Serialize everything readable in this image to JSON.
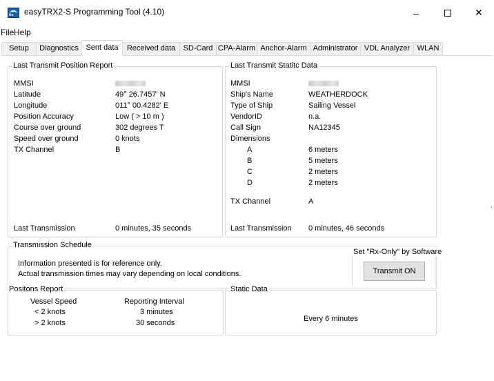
{
  "window": {
    "title": "easyTRX2-S Programming Tool  (4.10)",
    "icon_text": "trx",
    "minimize_glyph": "–",
    "close_glyph": "✕"
  },
  "menu": {
    "file": "File",
    "help": "Help"
  },
  "tabs": [
    {
      "label": "Setup"
    },
    {
      "label": "Diagnostics"
    },
    {
      "label": "Sent data",
      "active": true
    },
    {
      "label": "Received data"
    },
    {
      "label": "SD-Card"
    },
    {
      "label": "CPA-Alarm"
    },
    {
      "label": "Anchor-Alarm"
    },
    {
      "label": "Administrator"
    },
    {
      "label": "VDL Analyzer"
    },
    {
      "label": "WLAN"
    }
  ],
  "position_report": {
    "title": "Last Transmit Position Report",
    "rows": [
      {
        "label": "MMSI",
        "value": ""
      },
      {
        "label": "Latitude",
        "value": "49° 26.7457' N"
      },
      {
        "label": "Longitude",
        "value": "011° 00.4282' E"
      },
      {
        "label": "Position Accuracy",
        "value": "Low ( > 10 m )"
      },
      {
        "label": "Course over ground",
        "value": "302 degrees T"
      },
      {
        "label": "Speed over ground",
        "value": "0 knots"
      },
      {
        "label": "TX Channel",
        "value": "B"
      }
    ],
    "last_transmission_label": "Last Transmission",
    "last_transmission_value": "0 minutes, 35 seconds"
  },
  "static_data": {
    "title": "Last Transmit Statitc Data",
    "rows": [
      {
        "label": "MMSI",
        "value": ""
      },
      {
        "label": "Ship's Name",
        "value": "WEATHERDOCK"
      },
      {
        "label": "Type of Ship",
        "value": "Sailing Vessel"
      },
      {
        "label": "VendorID",
        "value": "n.a."
      },
      {
        "label": "Call Sign",
        "value": "NA12345"
      },
      {
        "label": "Dimensions",
        "value": ""
      }
    ],
    "dimensions": [
      {
        "label": "A",
        "value": "6 meters"
      },
      {
        "label": "B",
        "value": "5 meters"
      },
      {
        "label": "C",
        "value": "2 meters"
      },
      {
        "label": "D",
        "value": "2 meters"
      }
    ],
    "tx_channel_label": "TX Channel",
    "tx_channel_value": "A",
    "last_transmission_label": "Last Transmission",
    "last_transmission_value": "0 minutes, 46 seconds"
  },
  "schedule": {
    "title": "Transmission Schedule",
    "line1": "Information presented is for reference only.",
    "line2": "Actual transmission times may vary depending on local conditions.",
    "rx_only_title": "Set  \"Rx-Only\" by Software",
    "transmit_button": "Transmit ON"
  },
  "positions_report": {
    "title": "Positons Report",
    "col1": "Vessel Speed",
    "col2": "Reporting Interval",
    "rows": [
      {
        "speed": "< 2 knots",
        "interval": "3 minutes"
      },
      {
        "speed": "> 2 knots",
        "interval": "30 seconds"
      }
    ]
  },
  "static_schedule": {
    "title": "Static Data",
    "text": "Every 6 minutes"
  }
}
